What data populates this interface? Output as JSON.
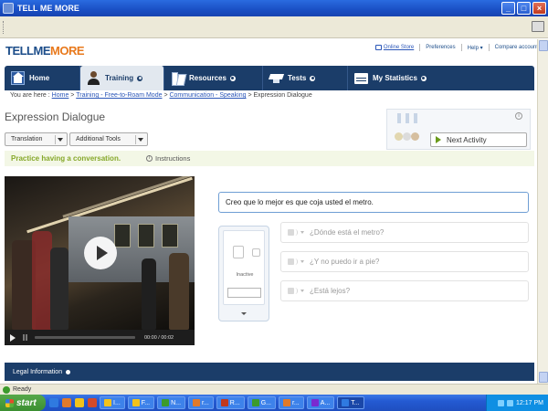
{
  "window": {
    "title": "TELL ME MORE"
  },
  "header": {
    "logo_part1": "TELLME",
    "logo_part2": "MORE",
    "online_store": "Online Store",
    "preferences": "Preferences",
    "help": "Help",
    "compare_accounts": "Compare accounts"
  },
  "nav": {
    "items": [
      {
        "label": "Home",
        "icon": "home-icon",
        "active": false
      },
      {
        "label": "Training",
        "icon": "user-icon",
        "active": true
      },
      {
        "label": "Resources",
        "icon": "book-icon",
        "active": false
      },
      {
        "label": "Tests",
        "icon": "graduation-cap-icon",
        "active": false
      },
      {
        "label": "My Statistics",
        "icon": "calendar-icon",
        "active": false
      }
    ]
  },
  "breadcrumb": {
    "prefix": "You are here : ",
    "items": [
      "Home",
      "Training - Free-to-Roam Mode",
      "Communication - Speaking"
    ],
    "current": "Expression Dialogue"
  },
  "page": {
    "title": "Expression Dialogue",
    "translation_dropdown": "Translation",
    "tools_dropdown": "Additional Tools",
    "next_activity": "Next Activity",
    "instruction_text": "Practice having a conversation.",
    "instructions_link": "Instructions"
  },
  "video": {
    "time": "00:00 / 00:02"
  },
  "dialogue": {
    "active_line": "Creo que lo mejor es que coja usted el metro.",
    "options": [
      "¿Dónde está el metro?",
      "¿Y no puedo ir a pie?",
      "¿Está lejos?"
    ]
  },
  "recorder": {
    "status": "Inactive"
  },
  "footer": {
    "legal": "Legal Information"
  },
  "statusbar": {
    "text": "Ready"
  },
  "taskbar": {
    "start": "start",
    "buttons": [
      "I...",
      "F...",
      "N...",
      "r...",
      "R...",
      "G...",
      "r...",
      "A...",
      "T..."
    ],
    "clock": "12:17 PM"
  },
  "colors": {
    "nav_bg": "#1b3d69",
    "accent_green": "#86a82a",
    "logo_orange": "#e8791c",
    "link_blue": "#2a56b8"
  }
}
